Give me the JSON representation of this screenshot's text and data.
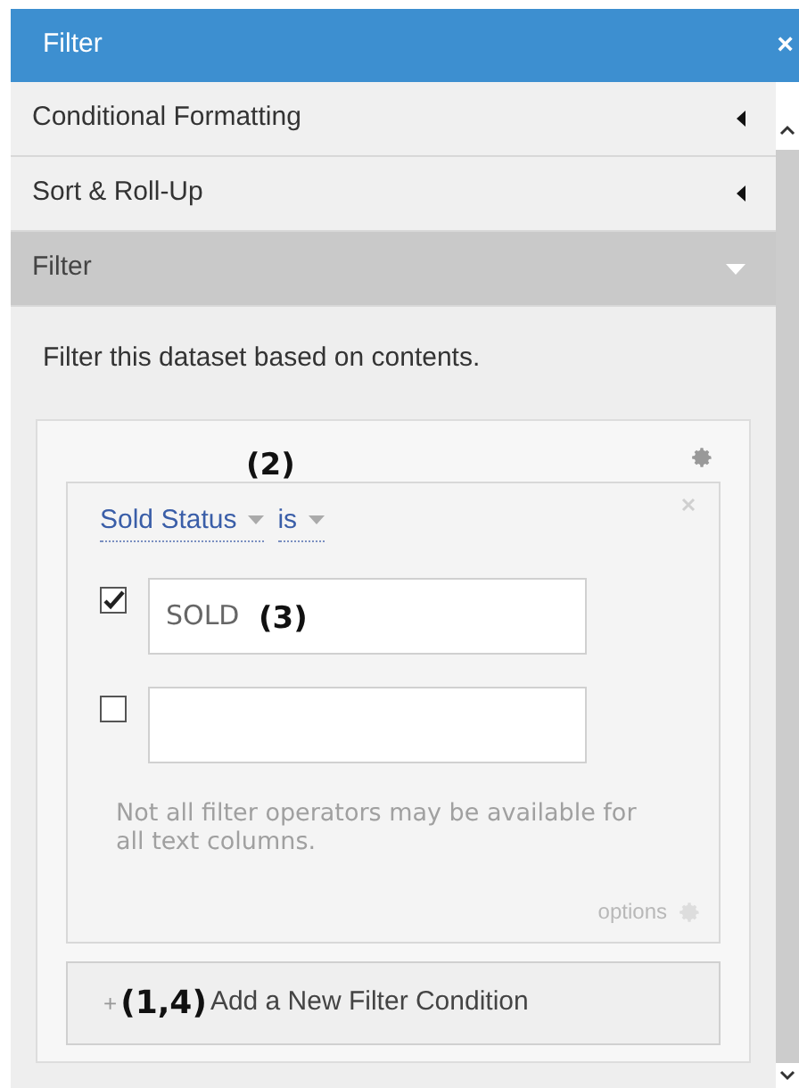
{
  "panel": {
    "title": "Filter",
    "close": "×"
  },
  "sections": [
    {
      "label": "Conditional Formatting",
      "expanded": false
    },
    {
      "label": "Sort & Roll-Up",
      "expanded": false
    },
    {
      "label": "Filter",
      "expanded": true
    }
  ],
  "description": "Filter this dataset based on contents.",
  "condition": {
    "annotation": "(2)",
    "column": "Sold Status",
    "operator": "is",
    "values": [
      {
        "checked": true,
        "value": "SOLD",
        "annotation": "(3)"
      },
      {
        "checked": false
      }
    ],
    "note": "Not all filter operators may be available for all text columns.",
    "options": "options"
  },
  "add_button": {
    "plus": "+",
    "annotation": "(1,4)",
    "label": "Add a New Filter Condition"
  }
}
